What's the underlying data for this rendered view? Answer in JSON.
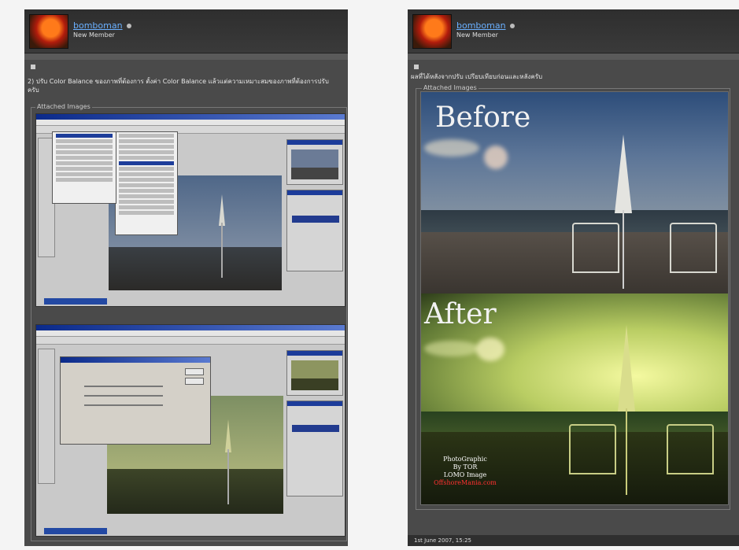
{
  "left_post": {
    "username": "bomboman",
    "rank": "New Member",
    "text": "2) ปรับ Color Balance ของภาพที่ต้องการ ตั้งค่า Color Balance แล้วแต่ความเหมาะสมของภาพที่ต้องการปรับ",
    "text_line2": "ครับ",
    "attached_label": "Attached Images"
  },
  "right_post": {
    "username": "bomboman",
    "rank": "New Member",
    "text": "ผลที่ได้หลังจากปรับ เปรียบเทียบก่อนและหลังครับ",
    "attached_label": "Attached Images",
    "before_label": "Before",
    "after_label": "After",
    "credit_line1": "PhotoGraphic",
    "credit_line2": "By TOR",
    "credit_line3": "LOMO Image",
    "credit_line4": "OffshoreMania.com",
    "footer": "1st June 2007, 15:25"
  },
  "colors": {
    "panel_bg": "#4a4a4a",
    "header_bg": "#2e2e2e",
    "username_link": "#6ab0ff",
    "credit_red": "#ff3030"
  }
}
